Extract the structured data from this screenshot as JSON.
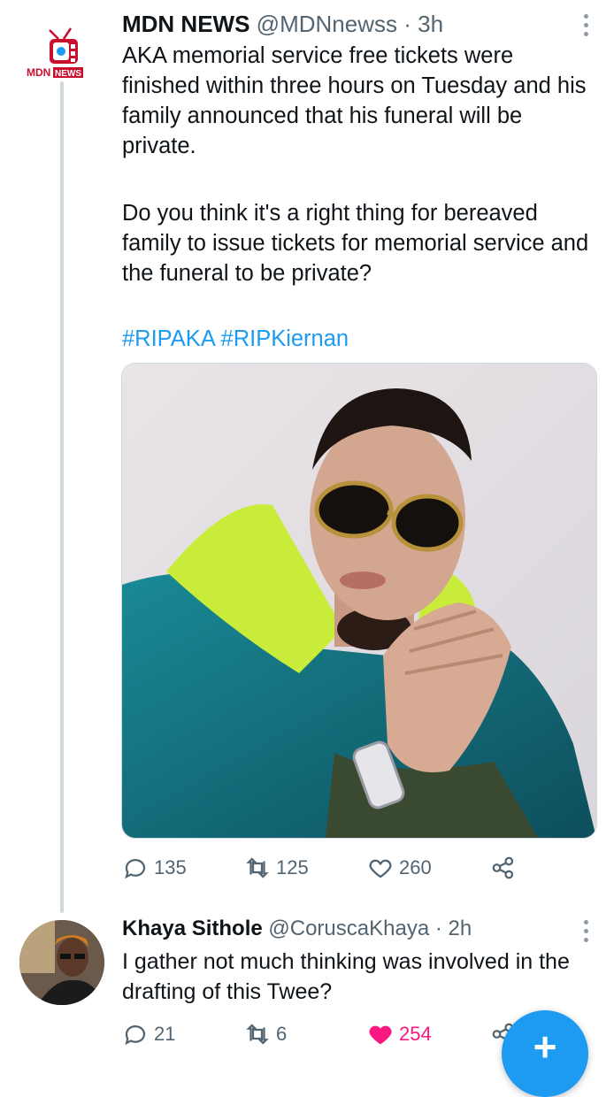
{
  "tweet": {
    "author_name": "MDN NEWS",
    "handle": "@MDNnewss",
    "separator": "·",
    "time": "3h",
    "avatar_text_left": "MDN",
    "avatar_text_right": "NEWS",
    "paragraph1": "AKA memorial service free tickets were finished within three hours on Tuesday and his family announced that his funeral will be private.",
    "paragraph2": "Do you think it's a right thing for bereaved family to issue tickets for memorial service and the funeral to be private?",
    "hashtags": [
      "#RIPAKA",
      "#RIPKiernan"
    ],
    "stats": {
      "replies": "135",
      "retweets": "125",
      "likes": "260"
    }
  },
  "reply": {
    "author_name": "Khaya Sithole",
    "handle": "@CoruscaKhaya",
    "separator": "·",
    "time": "2h",
    "text": "I gather not much thinking was involved in the drafting of this Twee?",
    "stats": {
      "replies": "21",
      "retweets": "6",
      "likes": "254"
    }
  },
  "fab": {
    "label": "+"
  },
  "colors": {
    "accent": "#1d9bf0",
    "like": "#f91880",
    "muted": "#536471",
    "text": "#0f1419"
  }
}
